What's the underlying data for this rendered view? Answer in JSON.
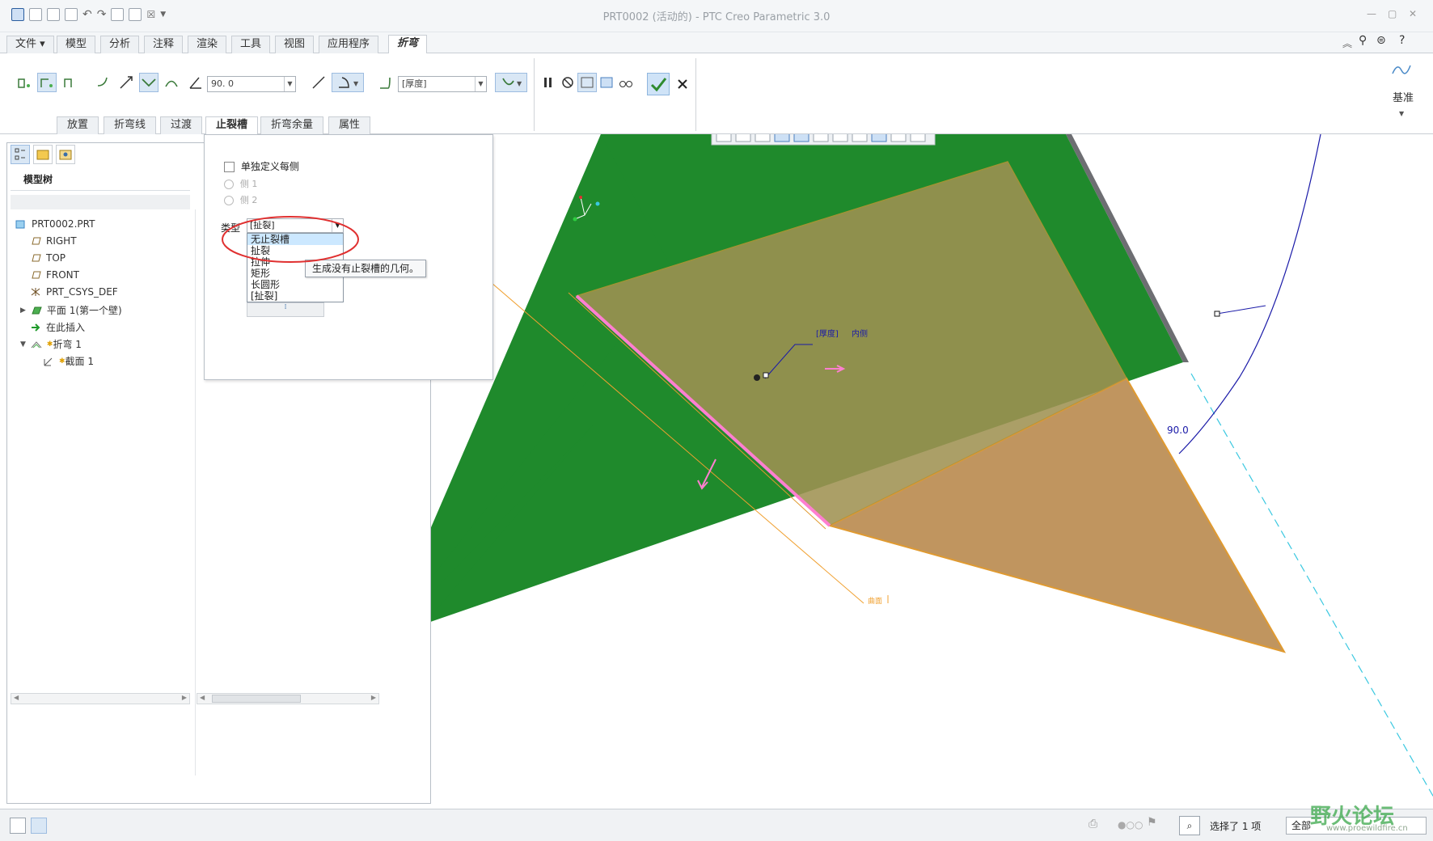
{
  "window": {
    "title": "PRT0002 (活动的) - PTC Creo Parametric 3.0"
  },
  "ribbon_tabs": [
    {
      "label": "文件",
      "active": false
    },
    {
      "label": "模型",
      "active": false
    },
    {
      "label": "分析",
      "active": false
    },
    {
      "label": "注释",
      "active": false
    },
    {
      "label": "渲染",
      "active": false
    },
    {
      "label": "工具",
      "active": false
    },
    {
      "label": "视图",
      "active": false
    },
    {
      "label": "应用程序",
      "active": false
    },
    {
      "label": "折弯",
      "active": true
    }
  ],
  "ribbon": {
    "angle_value": "90. 0",
    "thickness_value": "[厚度]",
    "datum_label": "基准"
  },
  "sub_tabs": [
    {
      "label": "放置",
      "active": false
    },
    {
      "label": "折弯线",
      "active": false
    },
    {
      "label": "过渡",
      "active": false
    },
    {
      "label": "止裂槽",
      "active": true
    },
    {
      "label": "折弯余量",
      "active": false
    },
    {
      "label": "属性",
      "active": false
    }
  ],
  "model_tree": {
    "title": "模型树",
    "items": [
      {
        "label": "PRT0002.PRT",
        "icon": "part-icon",
        "level": 0
      },
      {
        "label": "RIGHT",
        "icon": "datum-plane-icon",
        "level": 1
      },
      {
        "label": "TOP",
        "icon": "datum-plane-icon",
        "level": 1
      },
      {
        "label": "FRONT",
        "icon": "datum-plane-icon",
        "level": 1
      },
      {
        "label": "PRT_CSYS_DEF",
        "icon": "csys-icon",
        "level": 1
      },
      {
        "label": "平面 1(第一个壁)",
        "icon": "wall-icon",
        "level": 1
      },
      {
        "label": "在此插入",
        "icon": "insert-arrow-icon",
        "level": 1
      },
      {
        "label": "折弯 1",
        "icon": "bend-icon",
        "level": 1
      },
      {
        "label": "截面 1",
        "icon": "sketch-icon",
        "level": 2
      }
    ]
  },
  "relief_panel": {
    "define_each_side": "单独定义每侧",
    "side1": "侧 1",
    "side2": "侧 2",
    "type_label": "类型",
    "type_value": "[扯裂]",
    "options": [
      "无止裂槽",
      "扯裂",
      "拉伸",
      "矩形",
      "长圆形",
      "[扯裂]"
    ],
    "highlighted_option": "无止裂槽",
    "tooltip": "生成没有止裂槽的几何。"
  },
  "graphics": {
    "annotation_thickness": "[厚度]",
    "annotation_side": "内侧",
    "angle_dimension": "90.0",
    "surface_label": "曲面"
  },
  "status": {
    "selection": "选择了 1 项",
    "filter": "全部"
  },
  "watermark": {
    "text_cn": "野火论坛",
    "text_url": "www.proewildfire.cn"
  },
  "colors": {
    "green_plane": "#1f8a2c",
    "orange_wall": "#c0955f",
    "selection_pink": "#ff7fd0",
    "dim_blue": "#1a1aa8"
  }
}
